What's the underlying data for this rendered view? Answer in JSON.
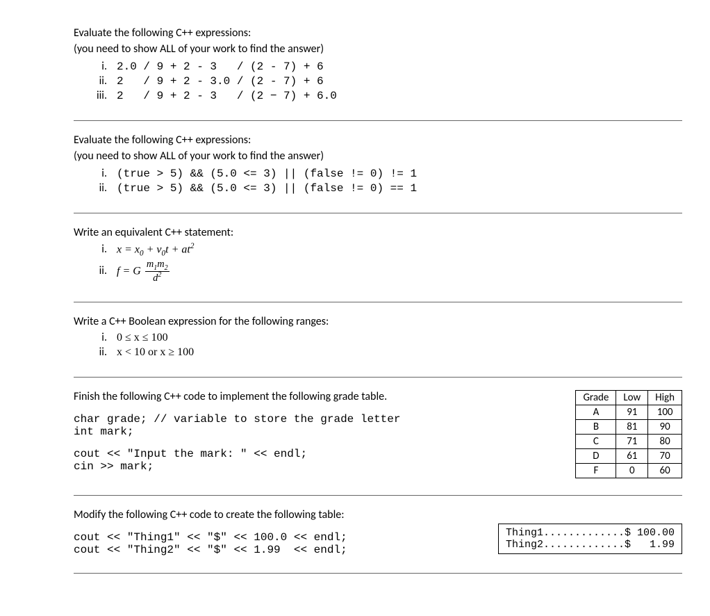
{
  "q1": {
    "prompt": "Evaluate the following C++ expressions:",
    "subprompt": "(you need to show ALL of your work to find the answer)",
    "items": [
      {
        "marker": "i.",
        "code": "2.0 / 9 + 2 - 3   / (2 - 7) + 6"
      },
      {
        "marker": "ii.",
        "code": "2   / 9 + 2 - 3.0 / (2 - 7) + 6"
      },
      {
        "marker": "iii.",
        "code": "2   / 9 + 2 - 3   / (2 − 7) + 6.0"
      }
    ]
  },
  "q2": {
    "prompt": "Evaluate the following C++ expressions:",
    "subprompt": "(you need to show ALL of your work to find the answer)",
    "items": [
      {
        "marker": "i.",
        "code": "(true > 5) && (5.0 <= 3) || (false != 0) != 1"
      },
      {
        "marker": "ii.",
        "code": "(true > 5) && (5.0 <= 3) || (false != 0) == 1"
      }
    ]
  },
  "q3": {
    "prompt": "Write an equivalent C++ statement:",
    "items": [
      {
        "marker": "i."
      },
      {
        "marker": "ii."
      }
    ],
    "eq1": {
      "x": "x",
      "x0": "x",
      "x0sub": "0",
      "v0": "v",
      "v0sub": "0",
      "t": "t",
      "a": "a",
      "t2sup": "2"
    },
    "eq2": {
      "f": "f",
      "G": "G",
      "m1": "m",
      "m1sub": "1",
      "m2": "m",
      "m2sub": "2",
      "d": "d",
      "d2sup": "2"
    }
  },
  "q4": {
    "prompt": "Write a C++ Boolean expression for the following ranges:",
    "items": [
      {
        "marker": "i.",
        "text": "0 ≤ x ≤ 100"
      },
      {
        "marker": "ii.",
        "text": "x < 10 or x ≥ 100"
      }
    ]
  },
  "q5": {
    "prompt": "Finish the following C++ code to implement the following grade table.",
    "code1": "char grade; // variable to store the grade letter\nint mark;",
    "code2": "cout << \"Input the mark: \" << endl;\ncin >> mark;",
    "table": {
      "headers": [
        "Grade",
        "Low",
        "High"
      ],
      "rows": [
        [
          "A",
          "91",
          "100"
        ],
        [
          "B",
          "81",
          "90"
        ],
        [
          "C",
          "71",
          "80"
        ],
        [
          "D",
          "61",
          "70"
        ],
        [
          "F",
          "0",
          "60"
        ]
      ]
    }
  },
  "q6": {
    "prompt": "Modify the following C++ code to create the following table:",
    "code": "cout << \"Thing1\" << \"$\" << 100.0 << endl;\ncout << \"Thing2\" << \"$\" << 1.99  << endl;",
    "box": "Thing1.............$ 100.00\nThing2.............$   1.99"
  }
}
